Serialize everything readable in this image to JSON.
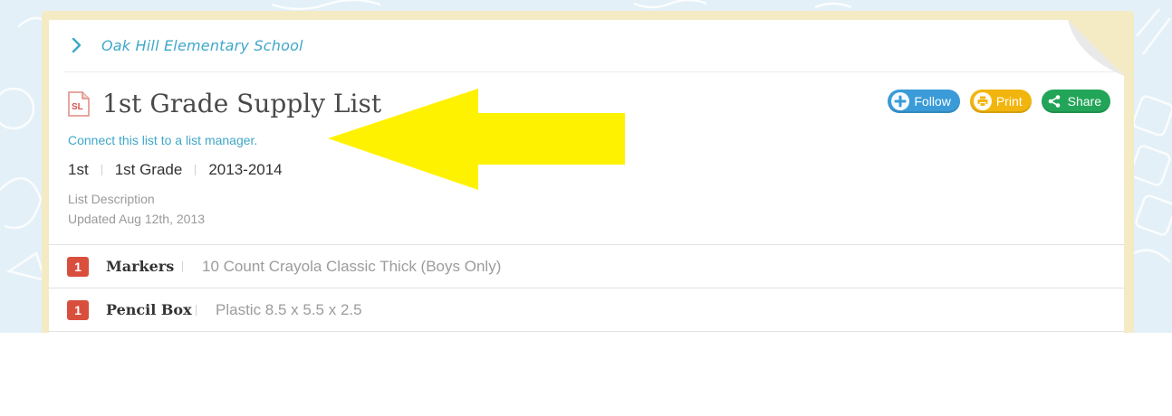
{
  "breadcrumb": {
    "school": "Oak Hill Elementary School"
  },
  "list": {
    "icon_text": "SL",
    "title": "1st Grade Supply List",
    "connect_link": "Connect this list to a list manager.",
    "meta": [
      "1st",
      "1st Grade",
      "2013-2014"
    ],
    "description_label": "List Description",
    "updated": "Updated Aug 12th, 2013"
  },
  "actions": {
    "follow_label": "Follow",
    "print_label": "Print",
    "share_label": "Share"
  },
  "items": [
    {
      "qty": "1",
      "name": "Markers",
      "description": "10 Count Crayola Classic Thick (Boys Only)"
    },
    {
      "qty": "1",
      "name": "Pencil Box",
      "description": "Plastic 8.5 x 5.5 x 2.5"
    }
  ],
  "colors": {
    "link": "#3fa7c9",
    "follow": "#3a9bd8",
    "print": "#f2b50d",
    "share": "#22a558",
    "qty_badge": "#d94f3d",
    "annotation_arrow": "#fff200"
  },
  "icons": [
    "chevron-right-icon",
    "document-icon",
    "plus-icon",
    "print-icon",
    "share-icon"
  ]
}
